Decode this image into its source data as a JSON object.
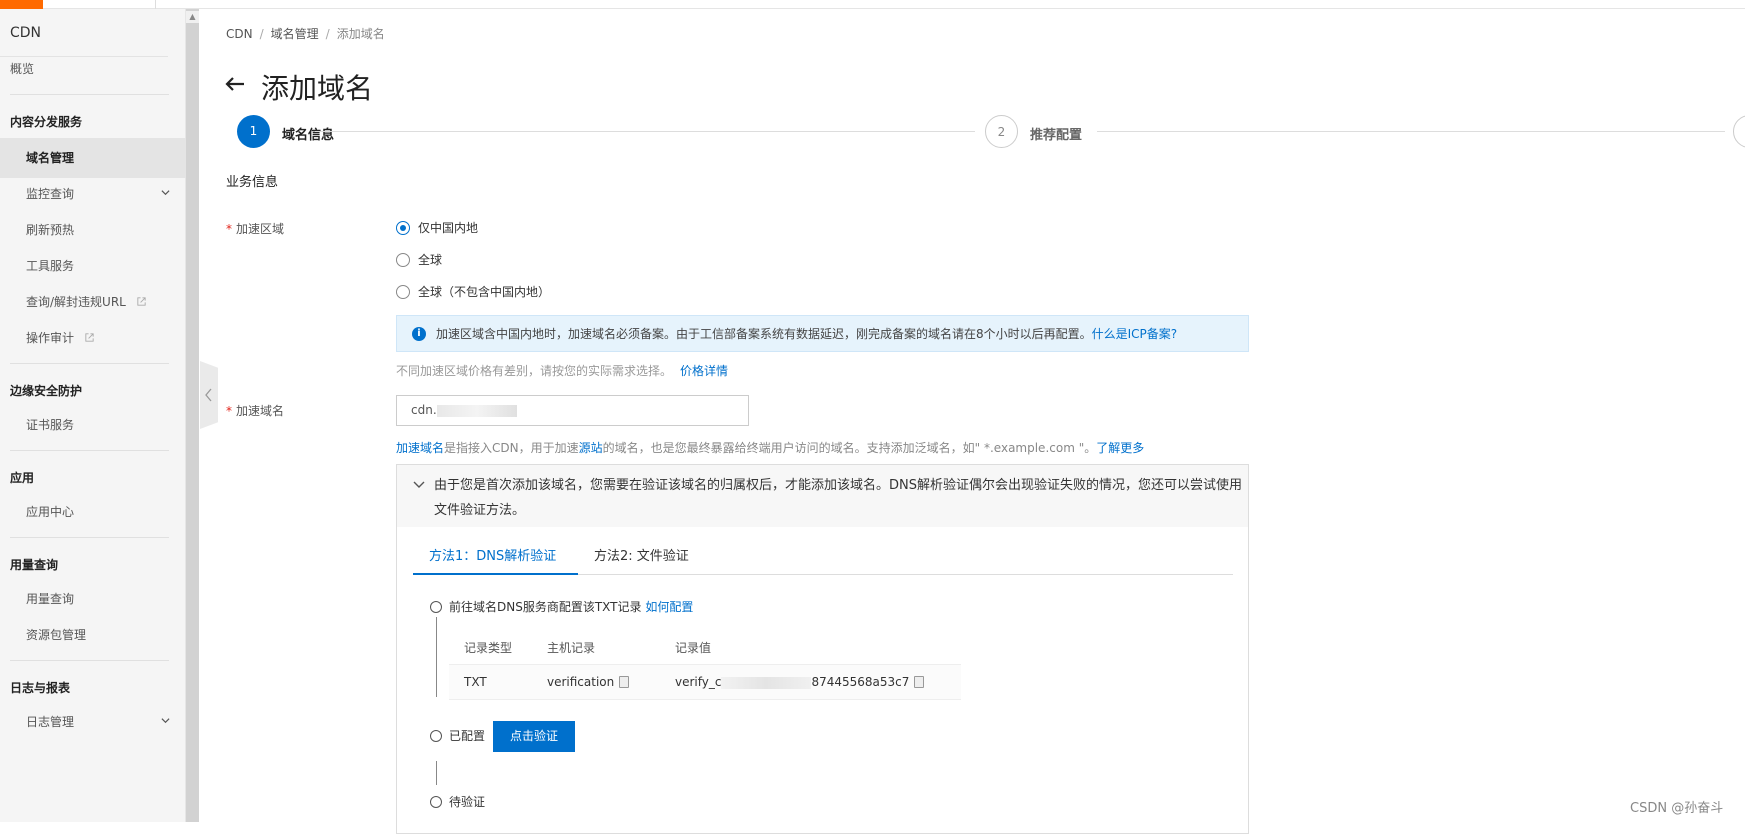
{
  "app": {
    "name": "CDN"
  },
  "sidebar": {
    "overview": "概览",
    "groups": [
      {
        "title": "内容分发服务",
        "items": [
          "域名管理",
          "监控查询",
          "刷新预热",
          "工具服务",
          "查询/解封违规URL",
          "操作审计"
        ]
      },
      {
        "title": "边缘安全防护",
        "items": [
          "证书服务"
        ]
      },
      {
        "title": "应用",
        "items": [
          "应用中心"
        ]
      },
      {
        "title": "用量查询",
        "items": [
          "用量查询",
          "资源包管理"
        ]
      },
      {
        "title": "日志与报表",
        "items": [
          "日志管理"
        ]
      }
    ],
    "active": "域名管理"
  },
  "breadcrumb": [
    "CDN",
    "域名管理",
    "添加域名"
  ],
  "page_title": "添加域名",
  "steps": [
    {
      "num": "1",
      "label": "域名信息",
      "state": "active"
    },
    {
      "num": "2",
      "label": "推荐配置",
      "state": "pending"
    }
  ],
  "form": {
    "section": "业务信息",
    "region_label": "加速区域",
    "region_options": [
      "仅中国内地",
      "全球",
      "全球（不包含中国内地）"
    ],
    "region_selected": "仅中国内地",
    "info_text": "加速区域含中国内地时，加速域名必须备案。由于工信部备案系统有数据延迟，刚完成备案的域名请在8个小时以后再配置。",
    "info_link": "什么是ICP备案?",
    "price_hint": "不同加速区域价格有差别，请按您的实际需求选择。",
    "price_link": "价格详情",
    "domain_label": "加速域名",
    "domain_value": "cdn.",
    "domain_hint_link1": "加速域名",
    "domain_hint_part1": "是指接入CDN，用于加速",
    "domain_hint_link2": "源站",
    "domain_hint_part2": "的域名，也是您最终暴露给终端用户访问的域名。支持添加泛域名，如\" *.example.com \"。",
    "domain_hint_link3": "了解更多"
  },
  "verify": {
    "message": "由于您是首次添加该域名，您需要在验证该域名的归属权后，才能添加该域名。DNS解析验证偶尔会出现验证失败的情况，您还可以尝试使用文件验证方法。",
    "tabs": [
      "方法1：DNS解析验证",
      "方法2: 文件验证"
    ],
    "step1_text": "前往域名DNS服务商配置该TXT记录",
    "step1_link": "如何配置",
    "table_headers": [
      "记录类型",
      "主机记录",
      "记录值"
    ],
    "record": {
      "type": "TXT",
      "host": "verification",
      "value_prefix": "verify_c",
      "value_suffix": "87445568a53c7"
    },
    "step2_text": "已配置",
    "verify_button": "点击验证",
    "step3_text": "待验证"
  },
  "watermark": "CSDN @孙奋斗",
  "colors": {
    "primary": "#0070cc",
    "brand": "#ff6a00",
    "required": "#e2231a"
  }
}
